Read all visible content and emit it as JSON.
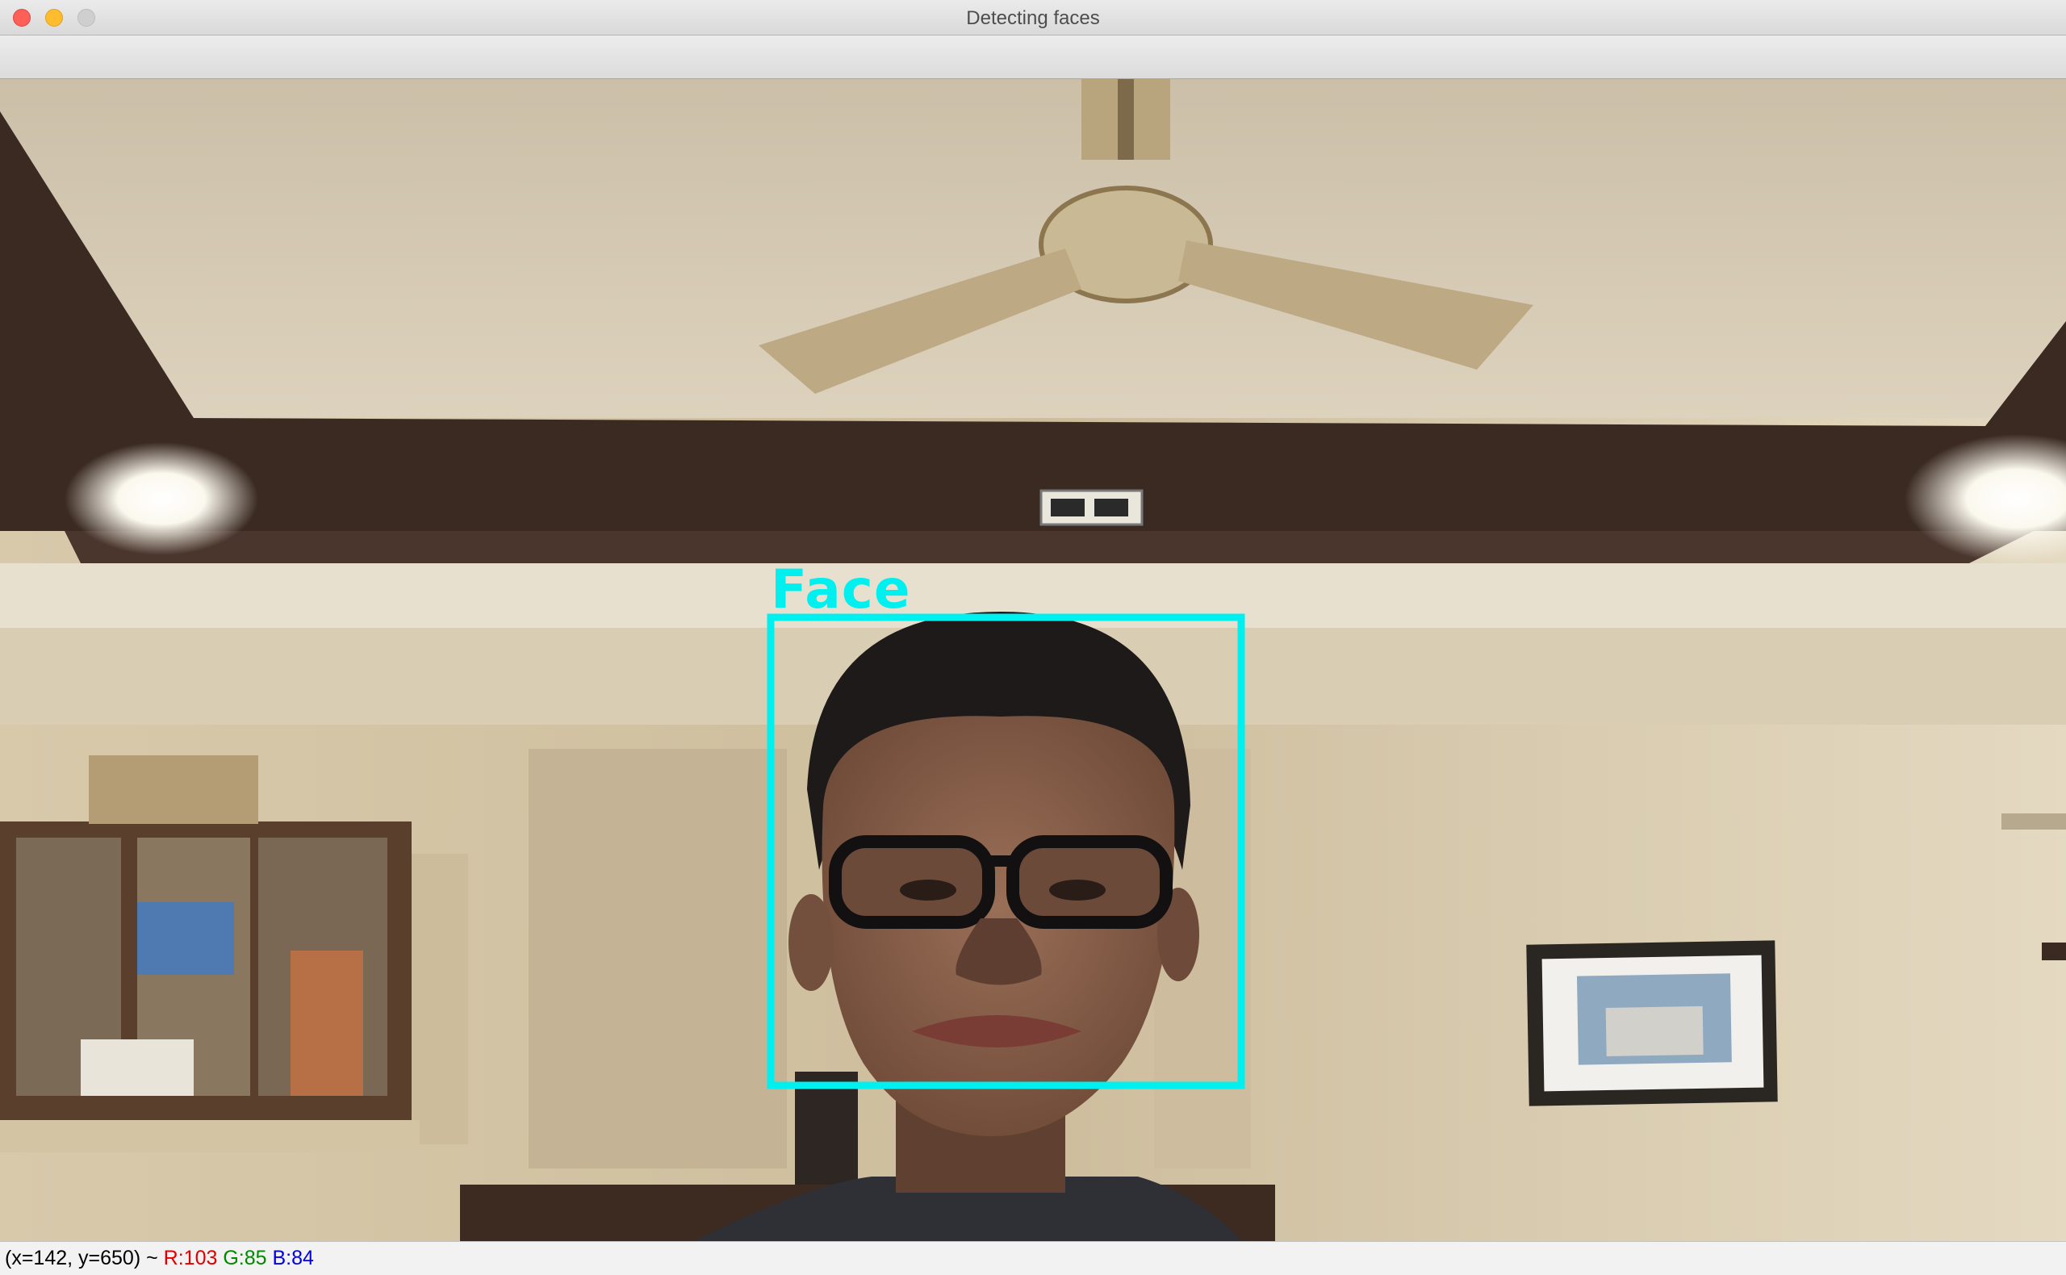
{
  "window": {
    "title": "Detecting faces"
  },
  "detection": {
    "label": "Face",
    "box_color": "#00f0f0"
  },
  "status": {
    "coords": "(x=142, y=650) ~",
    "r": "R:103",
    "g": "G:85",
    "b": "B:84"
  },
  "colors": {
    "r": "#e00000",
    "g": "#008800",
    "b": "#0000e0"
  }
}
